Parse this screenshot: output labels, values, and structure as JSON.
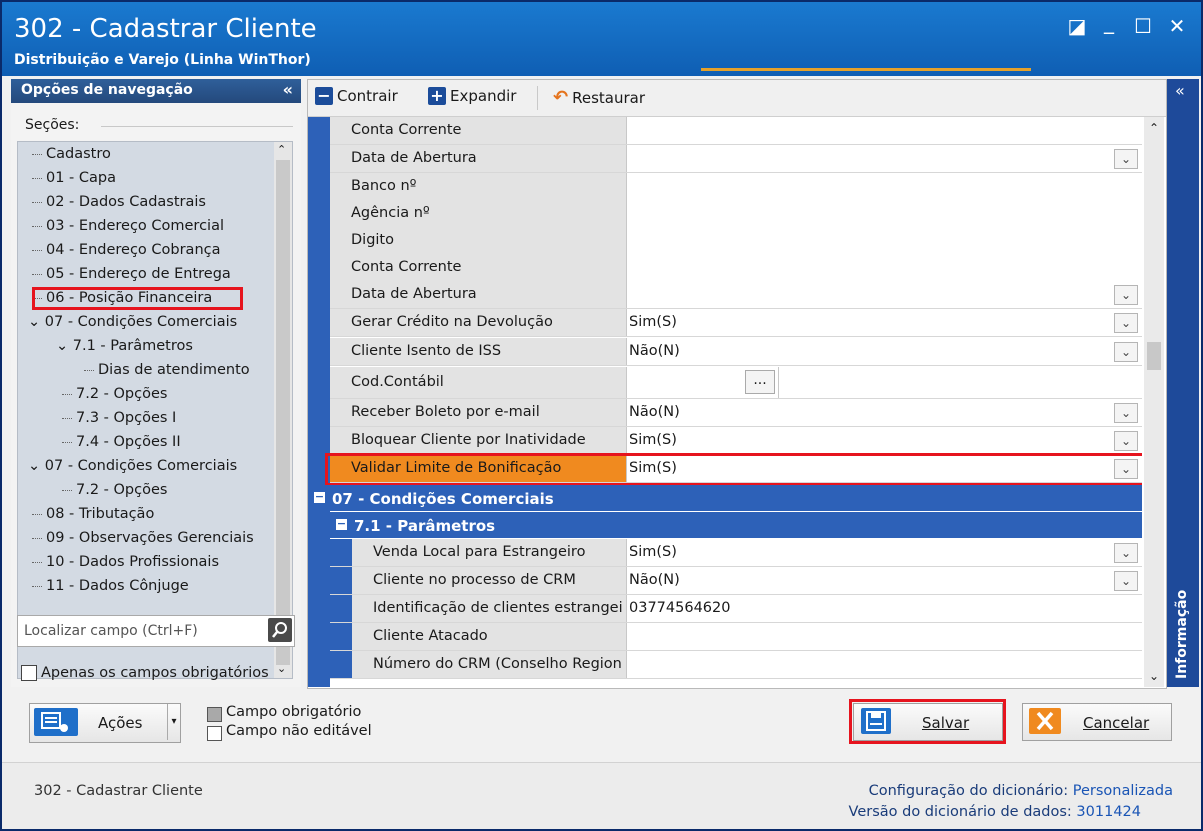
{
  "window": {
    "title": "302 - Cadastrar Cliente",
    "subtitle": "Distribuição e Varejo (Linha WinThor)",
    "controls": [
      "◪",
      "_",
      "☐",
      "✕"
    ]
  },
  "nav": {
    "header": "Opções de navegação",
    "collapse_glyph": "«",
    "sections_label": "Seções:",
    "items": [
      {
        "label": "Cadastro"
      },
      {
        "label": "01 - Capa"
      },
      {
        "label": "02 - Dados Cadastrais"
      },
      {
        "label": "03 - Endereço Comercial"
      },
      {
        "label": "04 - Endereço Cobrança"
      },
      {
        "label": "05 - Endereço de Entrega"
      },
      {
        "label": "06 - Posição Financeira"
      },
      {
        "label": "07 - Condições Comerciais"
      },
      {
        "label": "7.1 - Parâmetros"
      },
      {
        "label": "Dias de atendimento"
      },
      {
        "label": "7.2 - Opções"
      },
      {
        "label": "7.3 - Opções I"
      },
      {
        "label": "7.4 - Opções II"
      },
      {
        "label": "07 - Condições Comerciais"
      },
      {
        "label": "7.2 - Opções"
      },
      {
        "label": "08 - Tributação"
      },
      {
        "label": "09 - Observações Gerenciais"
      },
      {
        "label": "10 - Dados Profissionais"
      },
      {
        "label": "11 - Dados Cônjuge"
      }
    ],
    "search_placeholder": "Localizar campo (Ctrl+F)",
    "only_required_label": "Apenas os campos obrigatórios"
  },
  "toolbar": {
    "collapse": "Contrair",
    "expand": "Expandir",
    "restore": "Restaurar"
  },
  "fields": [
    {
      "label": "Conta Corrente",
      "value": ""
    },
    {
      "label": "Data de Abertura",
      "value": ""
    },
    {
      "label": "Banco nº",
      "value": ""
    },
    {
      "label": "Agência nº",
      "value": ""
    },
    {
      "label": "Digito",
      "value": ""
    },
    {
      "label": "Conta Corrente",
      "value": ""
    },
    {
      "label": "Data de Abertura",
      "value": ""
    },
    {
      "label": "Gerar Crédito na Devolução",
      "value": "Sim(S)"
    },
    {
      "label": "Cliente Isento de ISS",
      "value": "Não(N)"
    },
    {
      "label": "Cod.Contábil",
      "value": "..."
    },
    {
      "label": "Receber Boleto por e-mail",
      "value": "Não(N)"
    },
    {
      "label": "Bloquear Cliente por Inatividade",
      "value": "Sim(S)"
    },
    {
      "label": "Validar Limite de Bonificação",
      "value": "Sim(S)"
    }
  ],
  "group": {
    "title": "07 - Condições Comerciais",
    "sub_title": "7.1 - Parâmetros",
    "sub_fields": [
      {
        "label": "Venda Local para Estrangeiro",
        "value": "Sim(S)"
      },
      {
        "label": "Cliente no processo de CRM",
        "value": "Não(N)"
      },
      {
        "label": "Identificação de clientes estrangei",
        "value": "03774564620"
      },
      {
        "label": "Cliente Atacado",
        "value": ""
      },
      {
        "label": "Número do CRM (Conselho Region",
        "value": ""
      }
    ]
  },
  "side_tab": "Informação",
  "bottom": {
    "actions": "Ações",
    "legend_required": "Campo obrigatório",
    "legend_not_editable": "Campo não editável",
    "save": "Salvar",
    "cancel": "Cancelar"
  },
  "status": {
    "left": "302 - Cadastrar Cliente",
    "dict_config_label": "Configuração do dicionário:",
    "dict_config_value": "Personalizada",
    "dict_version_label": "Versão do dicionário de dados:",
    "dict_version_value": "3011424"
  },
  "colors": {
    "title_bar": "#1570c8",
    "accent_blue": "#2d61b8",
    "highlight_orange": "#f08a1f",
    "highlight_red": "#e6141e"
  }
}
